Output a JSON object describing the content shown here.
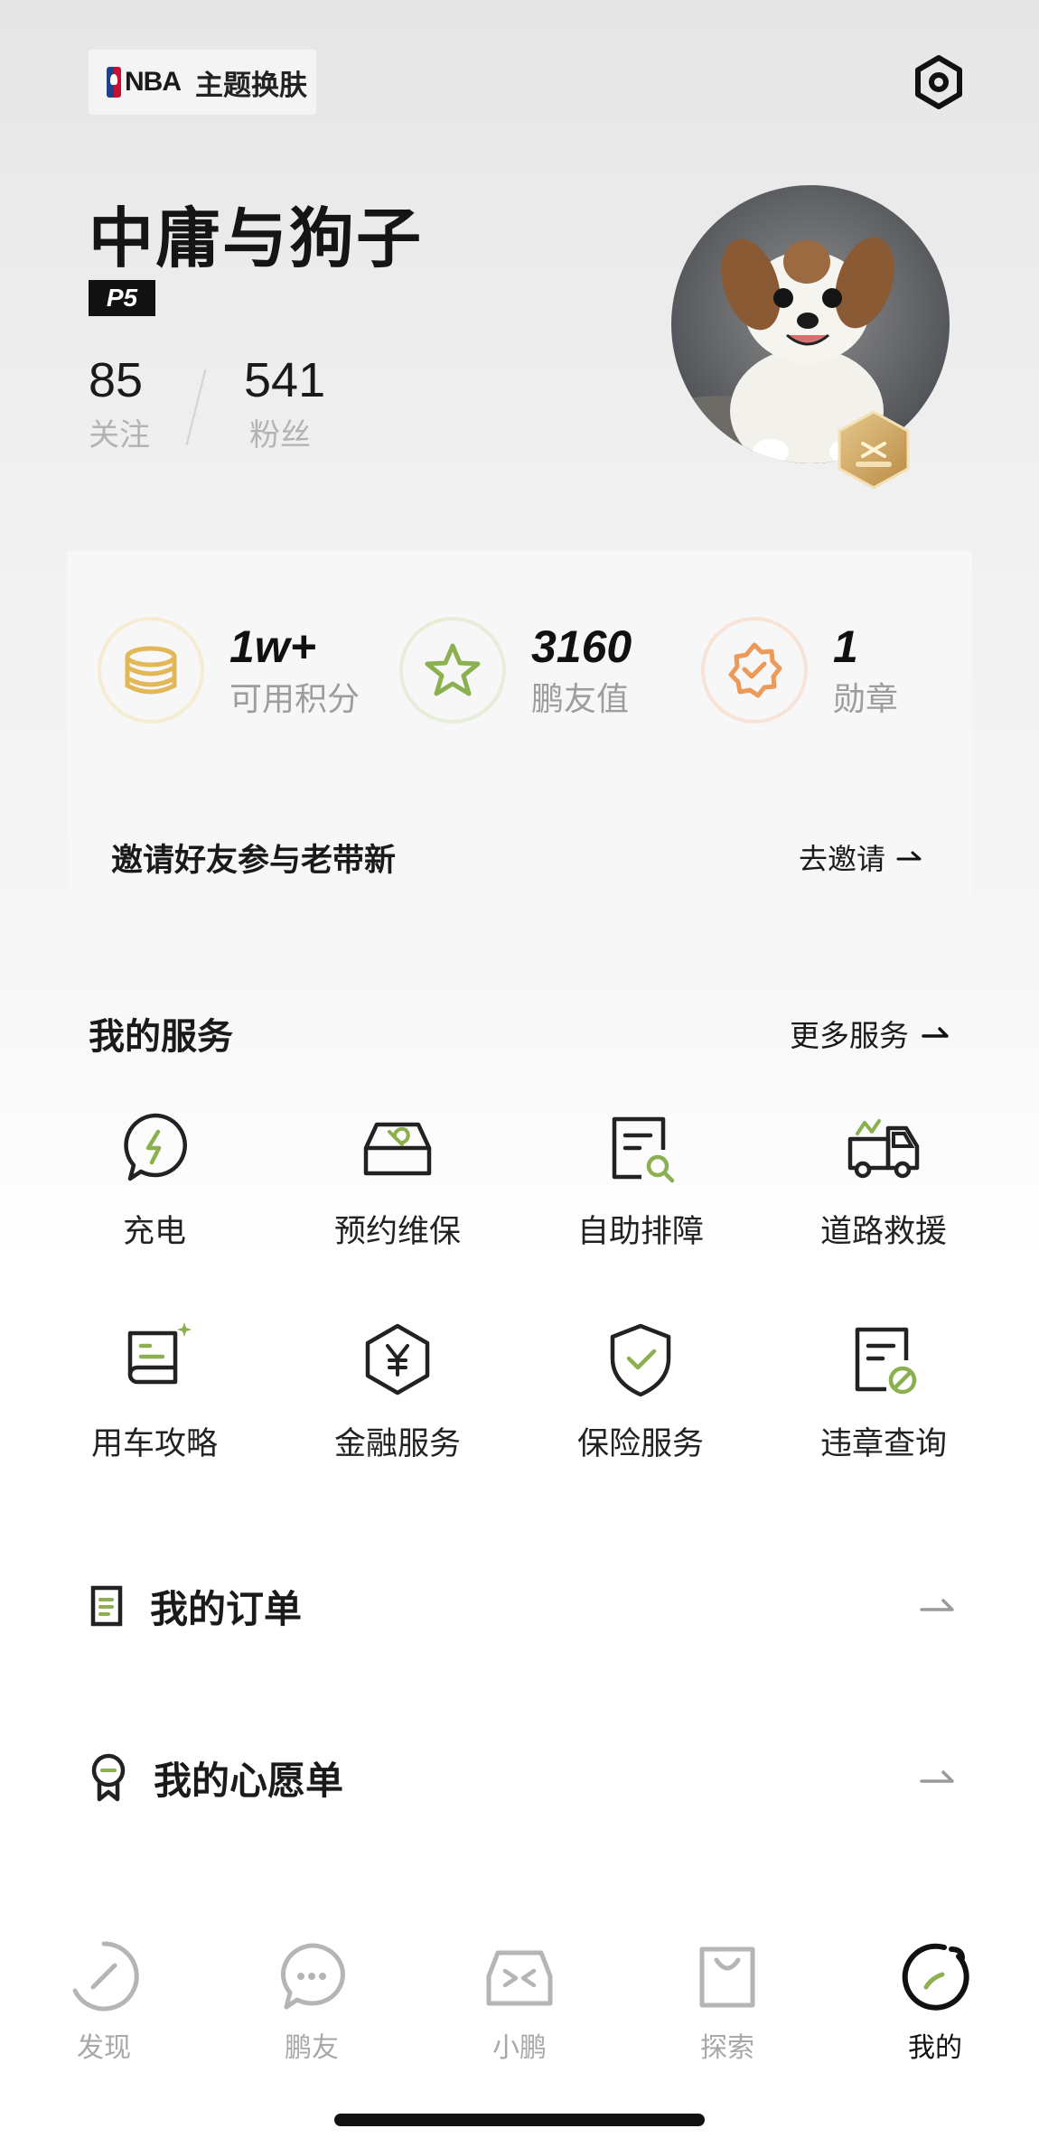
{
  "header": {
    "theme_brand": "NBA",
    "theme_label": "主题换肤"
  },
  "profile": {
    "username": "中庸与狗子",
    "level": "P5",
    "following_count": "85",
    "following_label": "关注",
    "followers_count": "541",
    "followers_label": "粉丝"
  },
  "stats": [
    {
      "value": "1w+",
      "label": "可用积分",
      "icon": "coins-icon",
      "color": "#e2b757"
    },
    {
      "value": "3160",
      "label": "鹏友值",
      "icon": "star-icon",
      "color": "#8bb04f"
    },
    {
      "value": "1",
      "label": "勋章",
      "icon": "badge-icon",
      "color": "#eb9a5a"
    }
  ],
  "invite": {
    "text": "邀请好友参与老带新",
    "button": "去邀请"
  },
  "services": {
    "title": "我的服务",
    "more": "更多服务",
    "items": [
      {
        "label": "充电",
        "icon": "charging-icon"
      },
      {
        "label": "预约维保",
        "icon": "maintenance-icon"
      },
      {
        "label": "自助排障",
        "icon": "troubleshoot-icon"
      },
      {
        "label": "道路救援",
        "icon": "tow-truck-icon"
      },
      {
        "label": "用车攻略",
        "icon": "guide-book-icon"
      },
      {
        "label": "金融服务",
        "icon": "finance-icon"
      },
      {
        "label": "保险服务",
        "icon": "insurance-shield-icon"
      },
      {
        "label": "违章查询",
        "icon": "violation-query-icon"
      }
    ]
  },
  "rows": [
    {
      "label": "我的订单",
      "icon": "order-icon"
    },
    {
      "label": "我的心愿单",
      "icon": "wishlist-icon"
    }
  ],
  "tabbar": [
    {
      "label": "发现",
      "icon": "discover-icon",
      "active": false
    },
    {
      "label": "鹏友",
      "icon": "chat-icon",
      "active": false
    },
    {
      "label": "小鹏",
      "icon": "car-icon",
      "active": false
    },
    {
      "label": "探索",
      "icon": "shopping-bag-icon",
      "active": false
    },
    {
      "label": "我的",
      "icon": "profile-icon",
      "active": true
    }
  ],
  "colors": {
    "accent_green": "#8bb04f",
    "gold": "#e2b757",
    "orange": "#eb9a5a"
  }
}
